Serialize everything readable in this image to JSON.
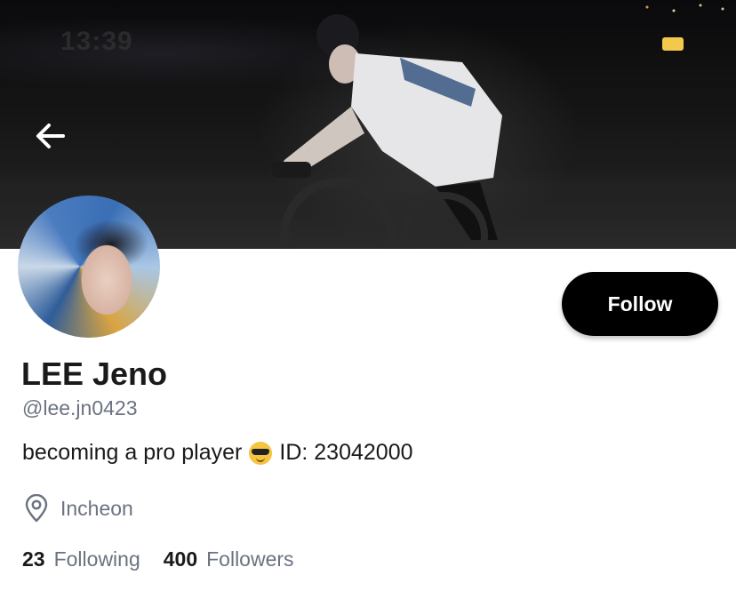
{
  "status_bar": {
    "time": "13:39"
  },
  "profile": {
    "name": "LEE Jeno",
    "handle": "@lee.jn0423",
    "bio_text": "becoming a pro player",
    "bio_emoji": "smiling-face-with-sunglasses",
    "bio_id": "ID: 23042000",
    "location": "Incheon"
  },
  "actions": {
    "follow_label": "Follow"
  },
  "stats": {
    "following_count": "23",
    "following_label": "Following",
    "followers_count": "400",
    "followers_label": "Followers"
  },
  "icons": {
    "back": "arrow-left-icon",
    "location": "map-pin-icon",
    "battery": "battery-icon"
  },
  "colors": {
    "follow_button_bg": "#000000",
    "secondary_text": "#6b7280",
    "battery": "#f2c94c"
  }
}
